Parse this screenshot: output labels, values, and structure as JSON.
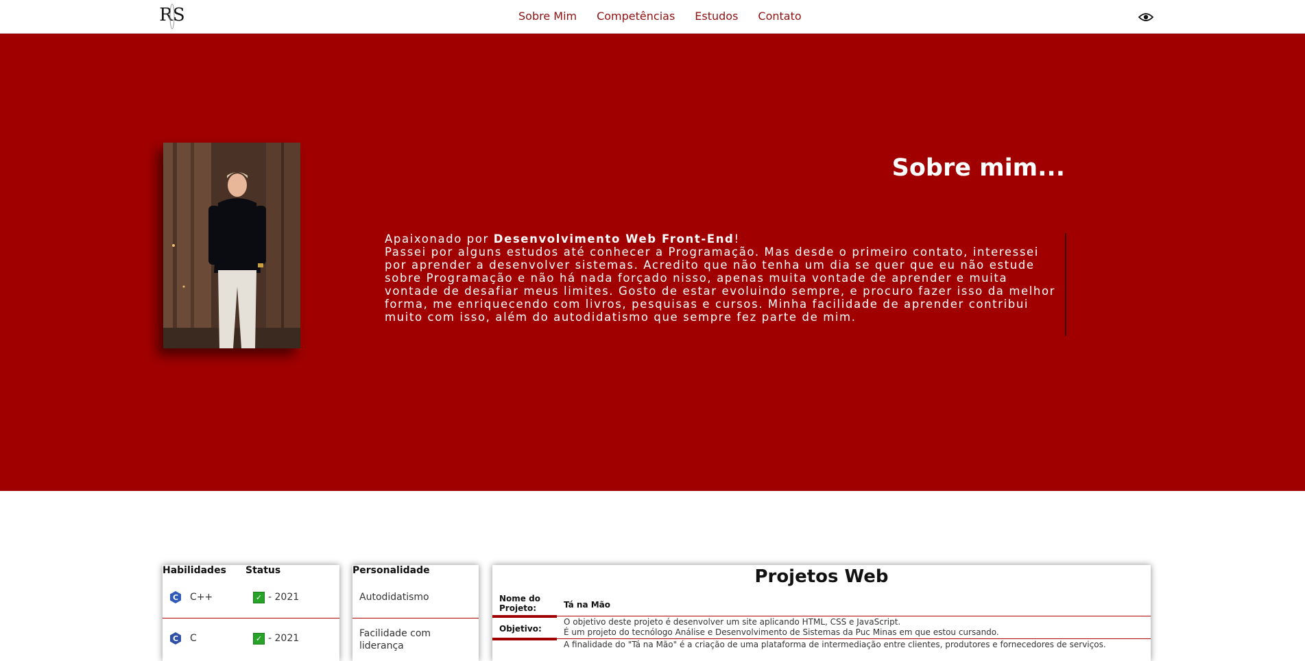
{
  "header": {
    "logo_text": "RS",
    "nav": [
      "Sobre Mim",
      "Competências",
      "Estudos",
      "Contato"
    ],
    "eye_icon": "eye-icon"
  },
  "hero": {
    "title": "Sobre mim...",
    "intro_prefix": "Apaixonado por ",
    "intro_bold": "Desenvolvimento Web Front-End",
    "intro_suffix": "!",
    "paragraph": "Passei por alguns estudos até conhecer a Programação. Mas desde o primeiro contato, interessei por aprender a desenvolver sistemas. Acredito que não tenha um dia se quer que eu não estude sobre Programação e não há nada forçado nisso, apenas muita vontade de aprender e muita vontade de desafiar meus limites. Gosto de estar evoluindo sempre, e procuro fazer isso da melhor forma, me enriquecendo com livros, pesquisas e cursos. Minha facilidade de aprender contribui muito com isso, além do autodidatismo que sempre fez parte de mim."
  },
  "skills": {
    "header_skill": "Habilidades",
    "header_status": "Status",
    "rows": [
      {
        "name": "C++",
        "status": "- 2021",
        "icon": "cpp-icon"
      },
      {
        "name": "C",
        "status": "- 2021",
        "icon": "c-icon"
      }
    ]
  },
  "personality": {
    "header": "Personalidade",
    "rows": [
      "Autodidatismo",
      "Facilidade com liderança"
    ]
  },
  "projects": {
    "title": "Projetos Web",
    "label_name": "Nome do Projeto:",
    "project_name": "Tá na Mão",
    "label_goal": "Objetivo:",
    "goal_line1": "O objetivo deste projeto é desenvolver um site aplicando HTML, CSS e JavaScript.",
    "goal_line2": "É um projeto do tecnólogo Análise e Desenvolvimento de Sistemas da Puc Minas em que estou cursando.",
    "goal_line3": "A finalidade do \"Tá na Mão\" é a criação de uma plataforma de intermediação entre clientes, produtores e fornecedores de serviços."
  },
  "colors": {
    "accent": "#a00000",
    "nav": "#8f1010"
  }
}
